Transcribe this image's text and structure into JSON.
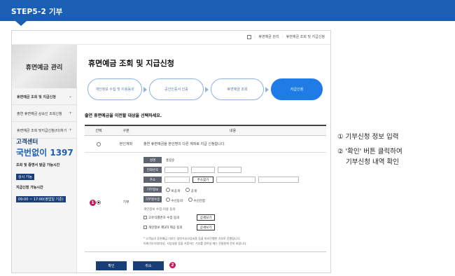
{
  "banner": {
    "title": "STEP5-2 기부"
  },
  "breadcrumb": {
    "items": [
      "휴면예금 관리",
      "휴면예금 조회 및 지급신청"
    ]
  },
  "sidebar": {
    "title": "휴면예금 관리",
    "items": [
      {
        "label": "휴면예금 조회 및 지급신청",
        "chevron": "⌄"
      },
      {
        "label": "출연 휴면예금 상속인 조회신청",
        "chevron": "+"
      },
      {
        "label": "휴면예금 조회 및지급신청(타)하기",
        "chevron": "+"
      }
    ]
  },
  "customer_center": {
    "title": "고객센터",
    "phone": "국번없이 1397",
    "sub1": "조회 및 증명서 발급 가능시간",
    "pill1": "상시 가능",
    "sub2": "지급신청 가능시간",
    "pill2": "09:00 ~ 17:00(영업일 기준)"
  },
  "main": {
    "title": "휴면예금 조회 및 지급신청",
    "steps": [
      {
        "label": "개인정보 수집 및 이용동의",
        "active": false
      },
      {
        "label": "공인인증서 인증",
        "active": false
      },
      {
        "label": "휴면예금 조회",
        "active": false
      },
      {
        "label": "지급신청",
        "active": true
      }
    ],
    "section_title": "출연 휴면예금을 이전할 대상을 선택하세요.",
    "table": {
      "headers": [
        "선택",
        "구분",
        "내용"
      ],
      "row1": {
        "category": "본인계좌",
        "content": "출연 휴면예금을 본인명의 다른 계좌로 지급 신청합니다."
      },
      "row2": {
        "category": "기부",
        "fields": {
          "name_label": "성명",
          "name_value": "홍길순",
          "phone_label": "전화번호",
          "address_label": "주소",
          "address_button": "주소찾기",
          "donation_info_label": "기부정보",
          "donation_info_opt1": "비공개",
          "donation_info_opt2": "공개",
          "receipt_label": "기부영수증",
          "receipt_opt1": "수신동의",
          "receipt_opt2": "수신안함",
          "consent_title": "개인정보 수집·이용 동의",
          "consent1": "고유식별번호 수집 동의",
          "consent2": "개인정보 제3자 제공 동의",
          "detail_button": "상세보기",
          "note1": "* 고객님의 휴면예금 기부는 일반기부사업내용 등을 따라진행한 기부로 진행됩니다.",
          "note2": "미래기부/지부대상, 사업내용 등을 지정하는 기부를 원하실 때는 전용창에 문의 바랍니다."
        }
      }
    },
    "confirm_button": "확인",
    "cancel_button": "취소"
  },
  "markers": {
    "m1": "1",
    "m2": "2"
  },
  "notes": {
    "line1": "① 기부신청 정보 입력",
    "line2": "② '확인' 버튼 클릭하여",
    "line3": "기부신청 내역 확인"
  },
  "colors": {
    "brand": "#1a5fb4",
    "navy": "#1a3f78",
    "step_active": "#1f7be6",
    "marker": "#c8175d"
  }
}
